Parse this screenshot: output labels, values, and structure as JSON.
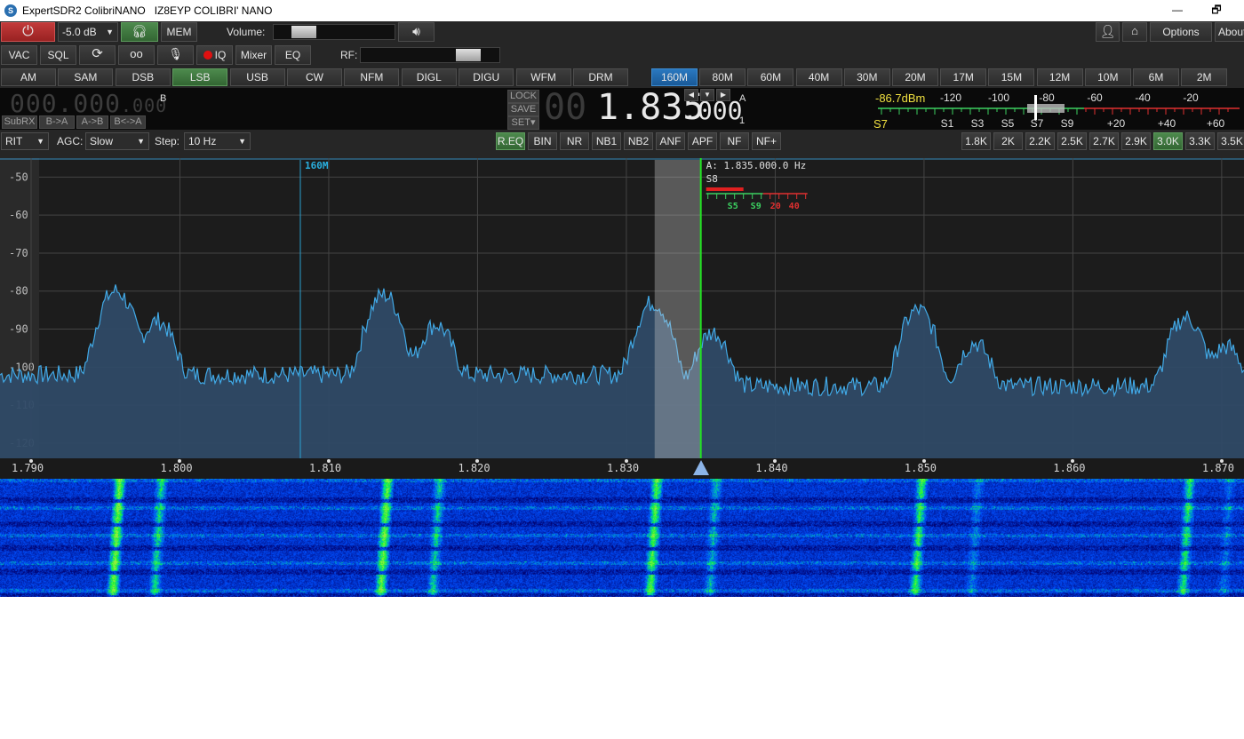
{
  "titlebar": {
    "title": "ExpertSDR2 ColibriNANO   IZ8EYP COLIBRI' NANO",
    "minimize": "—",
    "restore": "🗗"
  },
  "toolbar1": {
    "gain": "-5.0 dB",
    "mem": "MEM",
    "volume_label": "Volume:",
    "volume_level": 0.18,
    "options": "Options",
    "about": "About"
  },
  "toolbar2": {
    "vac": "VAC",
    "sql": "SQL",
    "iq": "IQ",
    "mixer": "Mixer",
    "eq": "EQ",
    "rf_label": "RF:",
    "rf_level": 0.82
  },
  "modes": [
    "AM",
    "SAM",
    "DSB",
    "LSB",
    "USB",
    "CW",
    "NFM",
    "DIGL",
    "DIGU",
    "WFM",
    "DRM"
  ],
  "active_mode": "LSB",
  "bands": [
    "160M",
    "80M",
    "60M",
    "40M",
    "30M",
    "20M",
    "17M",
    "15M",
    "12M",
    "10M",
    "6M",
    "2M"
  ],
  "active_band": "160M",
  "vfo_b": {
    "freq_main": "000.000",
    "freq_sub": ".000",
    "label": "B",
    "subrx": "SubRX",
    "b_to_a": "B->A",
    "a_to_b": "A->B",
    "swap": "B<->A"
  },
  "vfo_a": {
    "lock": "LOCK",
    "save": "SAVE",
    "set": "SET",
    "freq_dim": "00",
    "freq_main": "1.835",
    "freq_sub": ".000",
    "label": "A",
    "num": "1"
  },
  "smeter": {
    "dbm": "-86.7dBm",
    "s_value": "S7",
    "dbm_scale": [
      "-120",
      "-100",
      "-80",
      "-60",
      "-40",
      "-20"
    ],
    "s_scale": [
      "S1",
      "S3",
      "S5",
      "S7",
      "S9",
      "+20",
      "+40",
      "+60"
    ]
  },
  "toolbar3": {
    "rit": "RIT",
    "agc_label": "AGC:",
    "agc_value": "Slow",
    "step_label": "Step:",
    "step_value": "10 Hz",
    "dsp": [
      "R.EQ",
      "BIN",
      "NR",
      "NB1",
      "NB2",
      "ANF",
      "APF",
      "NF",
      "NF+"
    ],
    "filters": [
      "1.8K",
      "2K",
      "2.2K",
      "2.5K",
      "2.7K",
      "2.9K",
      "3.0K",
      "3.3K",
      "3.5K"
    ],
    "active_filter": "3.0K"
  },
  "spectrum": {
    "band_label": "160M",
    "cursor_freq": "A: 1.835.000.0 Hz",
    "cursor_s": "S8",
    "mini_scale": [
      "S5",
      "S9",
      "20",
      "40"
    ],
    "db_ticks": [
      "-50",
      "-60",
      "-70",
      "-80",
      "-90",
      "-100",
      "-110",
      "-120"
    ],
    "freq_ticks": [
      "1.790",
      "1.800",
      "1.810",
      "1.820",
      "1.830",
      "1.840",
      "1.850",
      "1.860",
      "1.870"
    ],
    "freq_range_mhz": [
      1.79,
      1.8715
    ],
    "db_range": [
      -45,
      -124
    ],
    "peaks": [
      {
        "f": 1.7957,
        "db": -80
      },
      {
        "f": 1.7985,
        "db": -88
      },
      {
        "f": 1.8137,
        "db": -81
      },
      {
        "f": 1.8172,
        "db": -89
      },
      {
        "f": 1.8318,
        "db": -83
      },
      {
        "f": 1.8358,
        "db": -91
      },
      {
        "f": 1.8496,
        "db": -85
      },
      {
        "f": 1.8534,
        "db": -94
      },
      {
        "f": 1.8676,
        "db": -87
      },
      {
        "f": 1.8703,
        "db": -95
      }
    ],
    "cursor_f": 1.835,
    "filter_lo_f": 1.8319,
    "filter_hi_f": 1.835
  }
}
